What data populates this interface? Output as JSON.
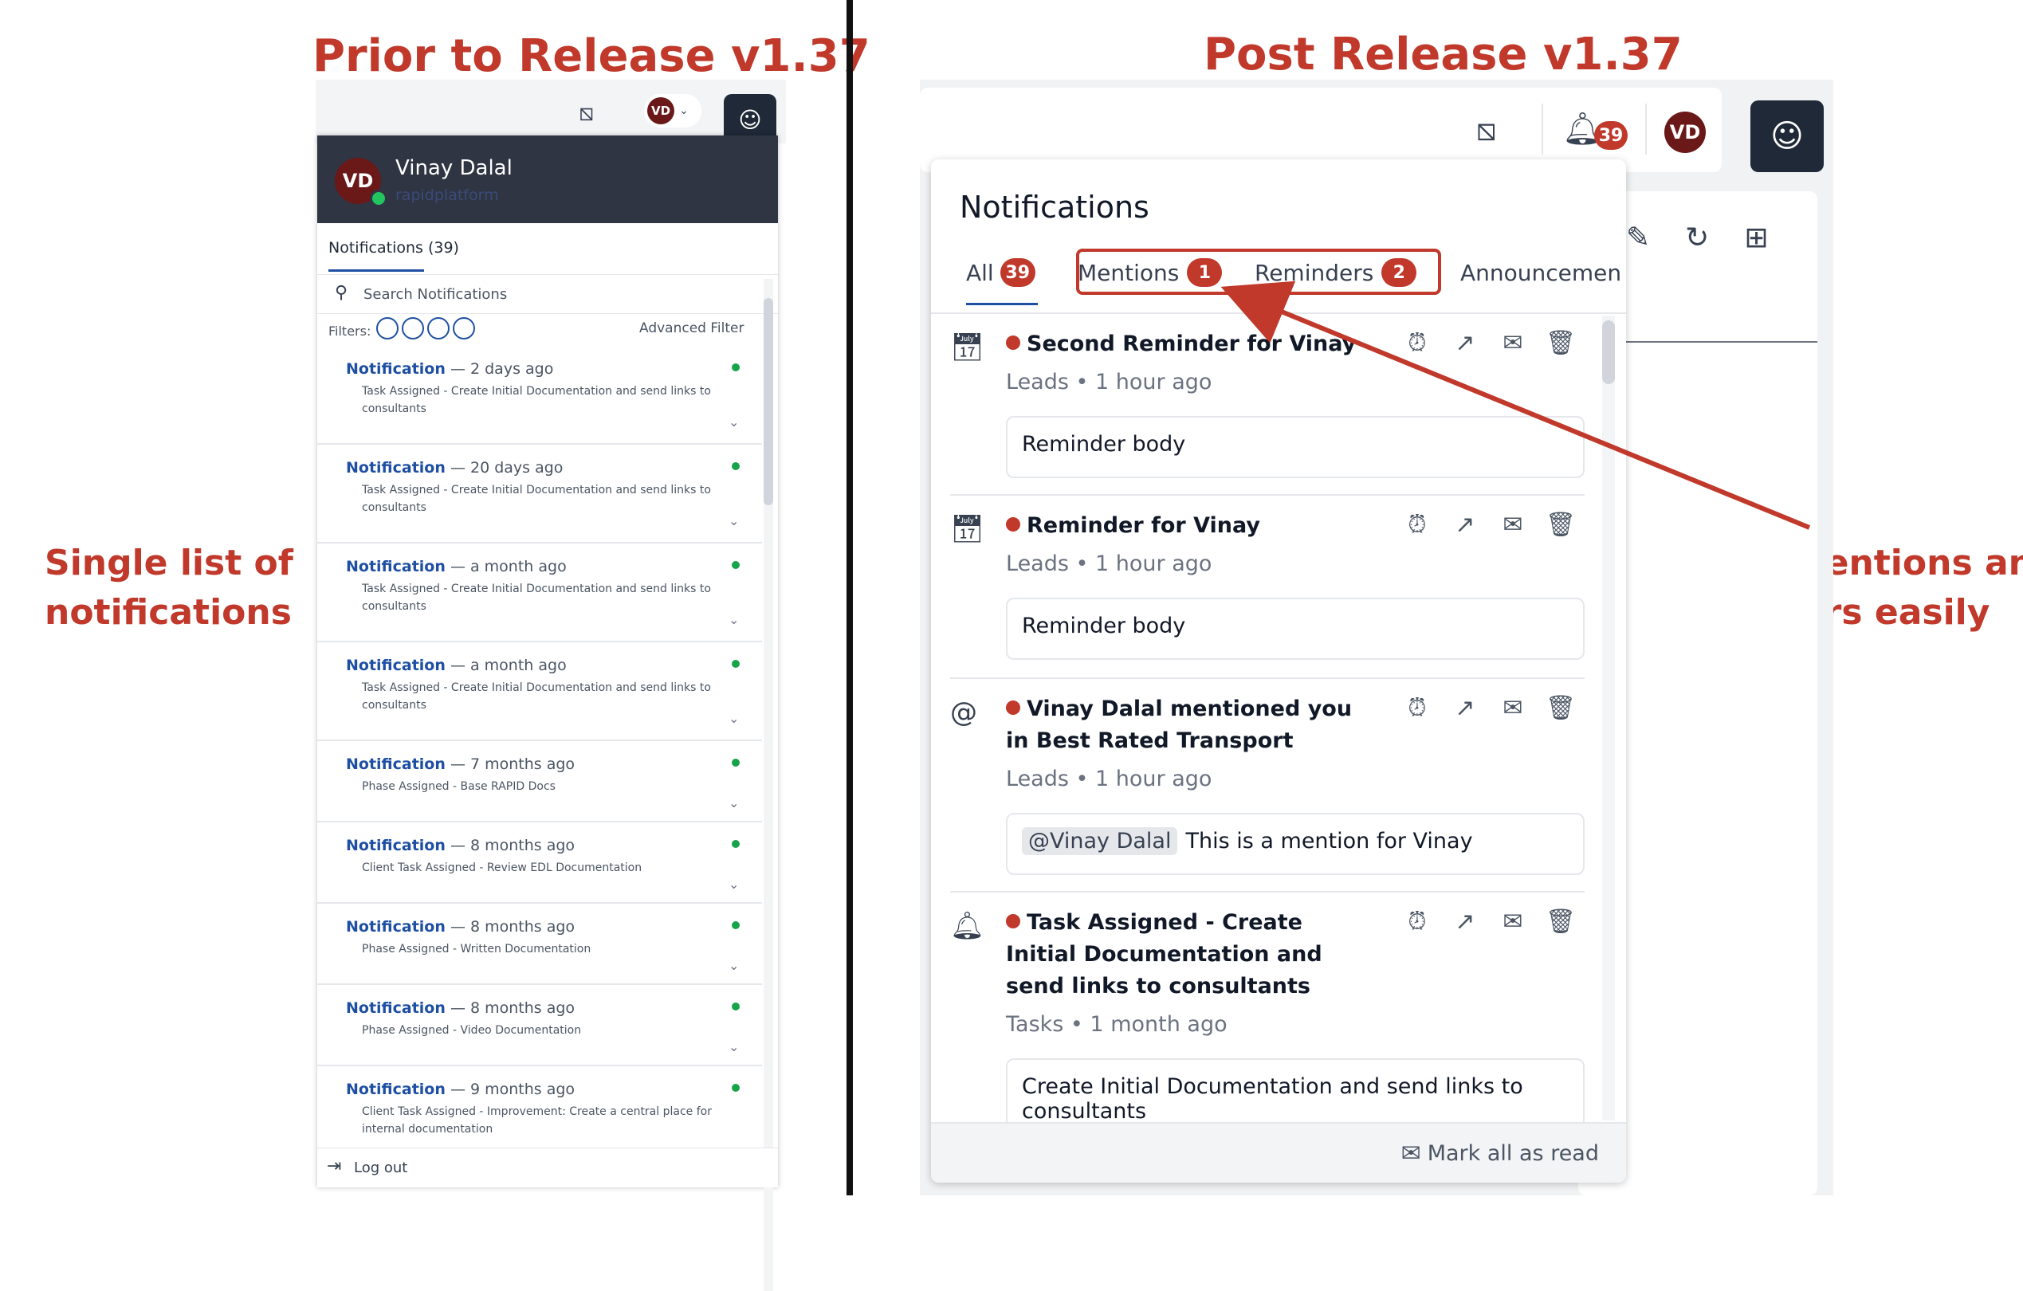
{
  "headings": {
    "prior": "Prior to Release v1.37",
    "post": "Post Release v1.37",
    "left_note": [
      "Single list of",
      "notifications"
    ],
    "right_note": [
      "Access mentions and",
      "reminders easily"
    ]
  },
  "colors": {
    "accent": "#c0392b",
    "dark_header": "#2f3542",
    "link_blue": "#1e4fa3",
    "online": "#16a34a"
  },
  "prior": {
    "avatar": "VD",
    "user_name": "Vinay Dalal",
    "org": "rapidplatform",
    "tab_label": "Notifications (39)",
    "search_placeholder": "Search Notifications",
    "filters_label": "Filters:",
    "advanced_filter": "Advanced Filter",
    "logout": "Log out",
    "items": [
      {
        "title": "Notification",
        "time": "— 2 days ago",
        "sub": "Task Assigned - Create Initial Documentation and send links to consultants"
      },
      {
        "title": "Notification",
        "time": "— 20 days ago",
        "sub": "Task Assigned - Create Initial Documentation and send links to consultants"
      },
      {
        "title": "Notification",
        "time": "— a month ago",
        "sub": "Task Assigned - Create Initial Documentation and send links to consultants"
      },
      {
        "title": "Notification",
        "time": "— a month ago",
        "sub": "Task Assigned - Create Initial Documentation and send links to consultants"
      },
      {
        "title": "Notification",
        "time": "— 7 months ago",
        "sub": "Phase Assigned - Base RAPID Docs"
      },
      {
        "title": "Notification",
        "time": "— 8 months ago",
        "sub": "Client Task Assigned - Review EDL Documentation"
      },
      {
        "title": "Notification",
        "time": "— 8 months ago",
        "sub": "Phase Assigned - Written Documentation"
      },
      {
        "title": "Notification",
        "time": "— 8 months ago",
        "sub": "Phase Assigned - Video Documentation"
      },
      {
        "title": "Notification",
        "time": "— 9 months ago",
        "sub": "Client Task Assigned - Improvement: Create a central place for internal documentation"
      }
    ]
  },
  "post": {
    "bell_count": "39",
    "avatar": "VD",
    "panel_title": "Notifications",
    "tabs": [
      {
        "label": "All",
        "count": "39"
      },
      {
        "label": "Mentions",
        "count": "1"
      },
      {
        "label": "Reminders",
        "count": "2"
      },
      {
        "label": "Announcemen",
        "count": ""
      }
    ],
    "items": [
      {
        "title": "Second Reminder for Vinay",
        "meta": "Leads • 1 hour ago",
        "body": "Reminder body",
        "icon": "calendar-clock-icon"
      },
      {
        "title": "Reminder for Vinay",
        "meta": "Leads • 1 hour ago",
        "body": "Reminder body",
        "icon": "calendar-clock-icon"
      },
      {
        "title": "Vinay Dalal mentioned you in Best Rated Transport",
        "meta": "Leads • 1 hour ago",
        "mention": "@Vinay Dalal",
        "body": "This is a mention for Vinay",
        "icon": "at-icon"
      },
      {
        "title": "Task Assigned - Create Initial Documentation and send links to consultants",
        "meta": "Tasks • 1 month ago",
        "body": "Create Initial Documentation and send links to consultants",
        "icon": "bell-icon"
      }
    ],
    "mark_all": "Mark all as read"
  }
}
